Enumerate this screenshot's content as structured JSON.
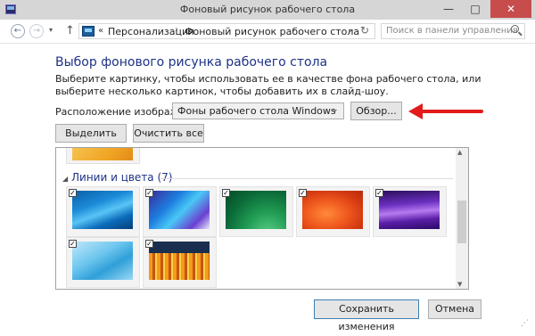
{
  "window": {
    "title": "Фоновый рисунок рабочего стола",
    "minimize": "—",
    "maximize": "□",
    "close": "✕"
  },
  "nav": {
    "back": "←",
    "forward": "→",
    "history": "▾",
    "up": "↑",
    "breadcrumb_sep": "«",
    "breadcrumb": [
      "Персонализация",
      "Фоновый рисунок рабочего стола"
    ],
    "crumb_arrow": "›",
    "dropdown": "⌄",
    "refresh": "↻",
    "search_placeholder": "Поиск в панели управления"
  },
  "main": {
    "title": "Выбор фонового рисунка рабочего стола",
    "description": "Выберите картинку, чтобы использовать ее в качестве фона рабочего стола, или выберите несколько картинок, чтобы добавить их в слайд-шоу.",
    "location_label": "Расположение изображения:",
    "location_value": "Фоны рабочего стола Windows",
    "browse": "Обзор...",
    "select_all": "Выделить все",
    "clear_all": "Очистить все"
  },
  "gallery": {
    "group_toggle": "◢",
    "group_label": "Линии и цвета (7)",
    "checkmark": "✓",
    "images": [
      {
        "name": "blue-lines",
        "checked": true
      },
      {
        "name": "blue-gradient-shapes",
        "checked": true
      },
      {
        "name": "green-curves",
        "checked": true
      },
      {
        "name": "orange-red-swirl",
        "checked": true
      },
      {
        "name": "purple-waves",
        "checked": true
      },
      {
        "name": "light-blue-ribbons",
        "checked": true
      },
      {
        "name": "orange-bars",
        "checked": true
      }
    ],
    "scroll_up": "▲",
    "scroll_down": "▼"
  },
  "footer": {
    "save": "Сохранить изменения",
    "cancel": "Отмена"
  },
  "colors": {
    "title_blue": "#1e3287",
    "annotation_red": "#e21b1b",
    "close_red": "#c74c4c"
  }
}
